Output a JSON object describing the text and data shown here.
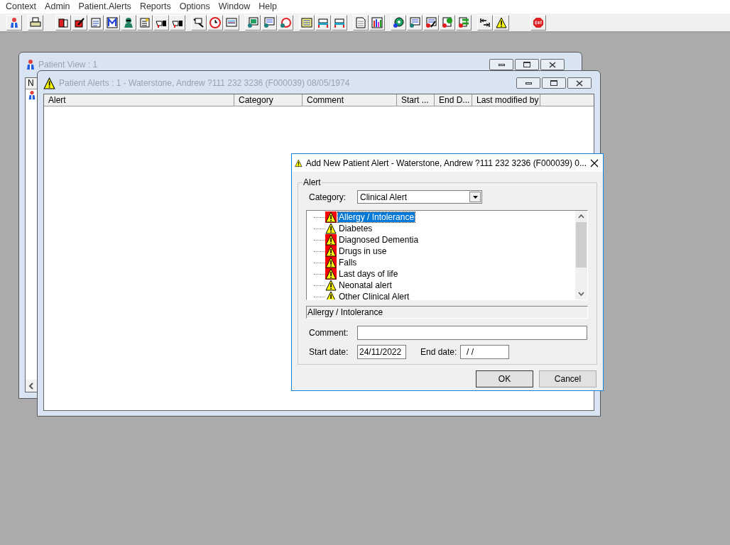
{
  "menu": [
    "Context",
    "Admin",
    "Patient.Alerts",
    "Reports",
    "Options",
    "Window",
    "Help"
  ],
  "patient_view": {
    "title": "Patient View : 1",
    "column_1": "N"
  },
  "patient_alerts": {
    "title": "Patient Alerts : 1 - Waterstone, Andrew ?111 232 3236 (F000039) 08/05/1974",
    "columns": [
      "Alert",
      "Category",
      "Comment",
      "Start ...",
      "End D...",
      "Last modified by"
    ]
  },
  "dialog": {
    "title": "Add New Patient Alert - Waterstone, Andrew ?111 232 3236 (F000039) 0...",
    "group": "Alert",
    "category_label": "Category:",
    "category": "Clinical Alert",
    "alerts": [
      {
        "label": "Allergy / Intolerance",
        "kind": "severe",
        "selected": true
      },
      {
        "label": "Diabetes",
        "kind": "normal",
        "selected": false
      },
      {
        "label": "Diagnosed Dementia",
        "kind": "severe",
        "selected": false
      },
      {
        "label": "Drugs in use",
        "kind": "severe",
        "selected": false
      },
      {
        "label": "Falls",
        "kind": "severe",
        "selected": false
      },
      {
        "label": "Last days of life",
        "kind": "severe",
        "selected": false
      },
      {
        "label": "Neonatal alert",
        "kind": "normal",
        "selected": false
      },
      {
        "label": "Other Clinical Alert",
        "kind": "normal",
        "selected": false
      }
    ],
    "selected_text": "Allergy / Intolerance",
    "comment_label": "Comment:",
    "start_date_label": "Start date:",
    "start_date": "24/11/2022",
    "end_date_label": "End date:",
    "end_date": "/ /",
    "buttons": [
      "OK",
      "Cancel"
    ]
  }
}
